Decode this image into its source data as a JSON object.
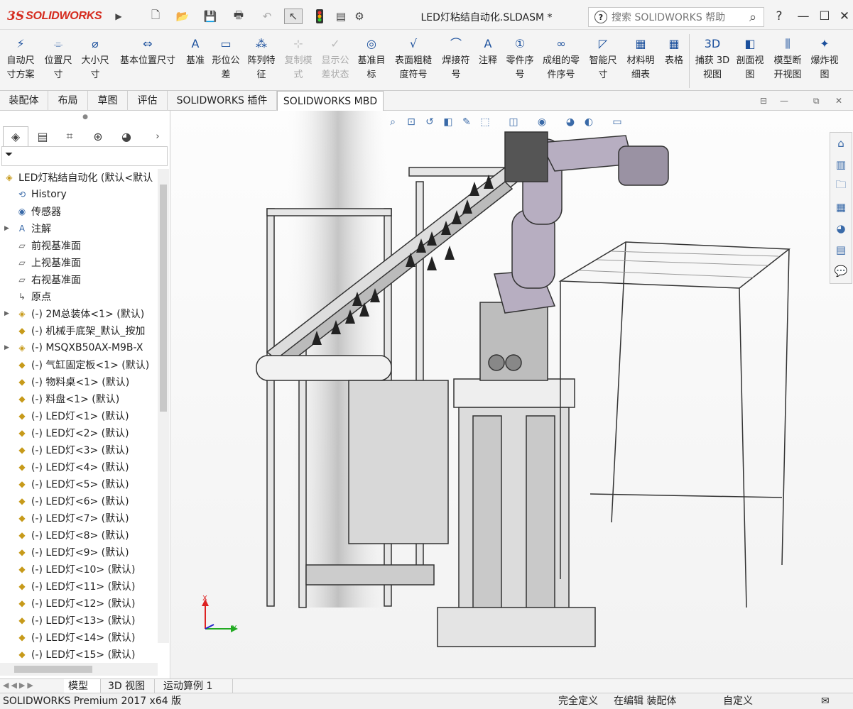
{
  "app": {
    "logo_ds": "3S",
    "logo_name": "SOLIDWORKS",
    "document_title": "LED灯粘结自动化.SLDASM *",
    "search_placeholder": "搜索 SOLIDWORKS 帮助",
    "help_label": "?",
    "accent": "#d52b1e"
  },
  "ribbon": {
    "buttons": [
      {
        "l1": "自动尺",
        "l2": "寸方案",
        "icon": "auto-dim-icon",
        "enabled": true
      },
      {
        "l1": "位置尺",
        "l2": "寸",
        "icon": "location-dim-icon",
        "enabled": true
      },
      {
        "l1": "大小尺",
        "l2": "寸",
        "icon": "size-dim-icon",
        "enabled": true
      },
      {
        "l1": "基本位置尺寸",
        "l2": "",
        "icon": "basic-location-dim-icon",
        "enabled": true
      },
      {
        "l1": "基准",
        "l2": "",
        "icon": "datum-icon",
        "enabled": true
      },
      {
        "l1": "形位公",
        "l2": "差",
        "icon": "geometric-tolerance-icon",
        "enabled": true
      },
      {
        "l1": "阵列特",
        "l2": "征",
        "icon": "pattern-feature-icon",
        "enabled": true
      },
      {
        "l1": "复制模",
        "l2": "式",
        "icon": "copy-scheme-icon",
        "enabled": false
      },
      {
        "l1": "显示公",
        "l2": "差状态",
        "icon": "show-tolerance-status-icon",
        "enabled": false
      },
      {
        "l1": "基准目",
        "l2": "标",
        "icon": "datum-target-icon",
        "enabled": true
      },
      {
        "l1": "表面粗糙",
        "l2": "度符号",
        "icon": "surface-finish-icon",
        "enabled": true
      },
      {
        "l1": "焊接符",
        "l2": "号",
        "icon": "weld-symbol-icon",
        "enabled": true
      },
      {
        "l1": "注释",
        "l2": "",
        "icon": "note-icon",
        "enabled": true
      },
      {
        "l1": "零件序",
        "l2": "号",
        "icon": "balloon-icon",
        "enabled": true
      },
      {
        "l1": "成组的零",
        "l2": "件序号",
        "icon": "stacked-balloon-icon",
        "enabled": true
      },
      {
        "l1": "智能尺",
        "l2": "寸",
        "icon": "smart-dimension-icon",
        "enabled": true
      },
      {
        "l1": "材料明",
        "l2": "细表",
        "icon": "bom-icon",
        "enabled": true
      },
      {
        "l1": "表格",
        "l2": "",
        "icon": "table-icon",
        "enabled": true
      },
      {
        "l1": "捕获 3D",
        "l2": "视图",
        "icon": "capture-3d-view-icon",
        "enabled": true
      },
      {
        "l1": "剖面视",
        "l2": "图",
        "icon": "section-view-icon",
        "enabled": true
      },
      {
        "l1": "模型断",
        "l2": "开视图",
        "icon": "model-break-view-icon",
        "enabled": true
      },
      {
        "l1": "爆炸视",
        "l2": "图",
        "icon": "exploded-view-icon",
        "enabled": true
      }
    ]
  },
  "tabs": [
    "装配体",
    "布局",
    "草图",
    "评估",
    "SOLIDWORKS 插件",
    "SOLIDWORKS MBD"
  ],
  "active_tab": "SOLIDWORKS MBD",
  "tree": {
    "root": "LED灯粘结自动化 (默认<默认",
    "items": [
      {
        "label": "History",
        "icon": "history-icon",
        "expand": false
      },
      {
        "label": "传感器",
        "icon": "sensor-icon",
        "expand": false
      },
      {
        "label": "注解",
        "icon": "annotation-icon",
        "expand": true
      },
      {
        "label": "前视基准面",
        "icon": "plane-icon",
        "expand": false
      },
      {
        "label": "上视基准面",
        "icon": "plane-icon",
        "expand": false
      },
      {
        "label": "右视基准面",
        "icon": "plane-icon",
        "expand": false
      },
      {
        "label": "原点",
        "icon": "origin-icon",
        "expand": false
      },
      {
        "label": "(-) 2M总装体<1> (默认)",
        "icon": "subassembly-icon",
        "expand": true
      },
      {
        "label": "(-) 机械手底架_默认_按加",
        "icon": "part-icon",
        "expand": false
      },
      {
        "label": "(-) MSQXB50AX-M9B-X",
        "icon": "subassembly-icon",
        "expand": true
      },
      {
        "label": "(-) 气缸固定板<1> (默认)",
        "icon": "part-icon",
        "expand": false
      },
      {
        "label": "(-) 物料桌<1> (默认)",
        "icon": "part-icon",
        "expand": false
      },
      {
        "label": "(-) 料盘<1> (默认)",
        "icon": "part-icon",
        "expand": false
      },
      {
        "label": "(-) LED灯<1> (默认)",
        "icon": "part-icon",
        "expand": false
      },
      {
        "label": "(-) LED灯<2> (默认)",
        "icon": "part-icon",
        "expand": false
      },
      {
        "label": "(-) LED灯<3> (默认)",
        "icon": "part-icon",
        "expand": false
      },
      {
        "label": "(-) LED灯<4> (默认)",
        "icon": "part-icon",
        "expand": false
      },
      {
        "label": "(-) LED灯<5> (默认)",
        "icon": "part-icon",
        "expand": false
      },
      {
        "label": "(-) LED灯<6> (默认)",
        "icon": "part-icon",
        "expand": false
      },
      {
        "label": "(-) LED灯<7> (默认)",
        "icon": "part-icon",
        "expand": false
      },
      {
        "label": "(-) LED灯<8> (默认)",
        "icon": "part-icon",
        "expand": false
      },
      {
        "label": "(-) LED灯<9> (默认)",
        "icon": "part-icon",
        "expand": false
      },
      {
        "label": "(-) LED灯<10> (默认)",
        "icon": "part-icon",
        "expand": false
      },
      {
        "label": "(-) LED灯<11> (默认)",
        "icon": "part-icon",
        "expand": false
      },
      {
        "label": "(-) LED灯<12> (默认)",
        "icon": "part-icon",
        "expand": false
      },
      {
        "label": "(-) LED灯<13> (默认)",
        "icon": "part-icon",
        "expand": false
      },
      {
        "label": "(-) LED灯<14> (默认)",
        "icon": "part-icon",
        "expand": false
      },
      {
        "label": "(-) LED灯<15> (默认)",
        "icon": "part-icon",
        "expand": false
      }
    ]
  },
  "bottom_tabs": [
    "模型",
    "3D 视图",
    "运动算例 1"
  ],
  "active_bottom_tab": "模型",
  "triad": {
    "x": "X",
    "y": "Y"
  },
  "status": {
    "product": "SOLIDWORKS Premium 2017 x64 版",
    "definition": "完全定义",
    "mode": "在编辑 装配体",
    "units": "自定义"
  }
}
